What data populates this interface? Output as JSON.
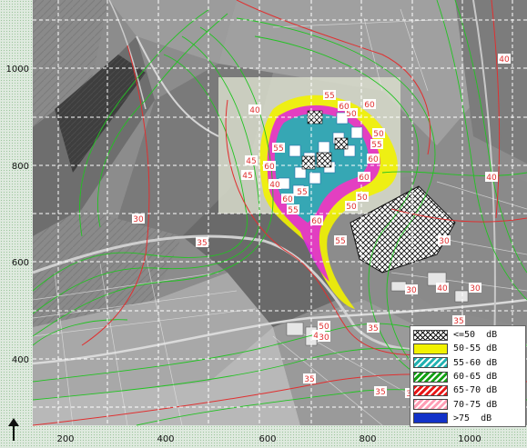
{
  "map": {
    "x_ticks": [
      "200",
      "400",
      "600",
      "800",
      "1000"
    ],
    "y_ticks": [
      "1000",
      "800",
      "600",
      "400"
    ],
    "contour_labels": [
      "55",
      "40",
      "50",
      "60",
      "60",
      "55",
      "45",
      "60",
      "50",
      "55",
      "60",
      "55",
      "50",
      "60",
      "45",
      "40",
      "50",
      "60",
      "55",
      "60",
      "55",
      "40",
      "30",
      "35",
      "50",
      "45",
      "35",
      "30",
      "35",
      "40",
      "30",
      "30",
      "30",
      "40",
      "35",
      "30",
      "35"
    ]
  },
  "legend": {
    "entries": [
      {
        "label": "<=50  dB",
        "color": "#ffffff",
        "pattern": "crosshatch"
      },
      {
        "label": "50-55 dB",
        "color": "#f2f200",
        "pattern": "solid"
      },
      {
        "label": "55-60 dB",
        "color": "#22b2b2",
        "pattern": "hatch"
      },
      {
        "label": "60-65 dB",
        "color": "#14a014",
        "pattern": "hatch"
      },
      {
        "label": "65-70 dB",
        "color": "#e81818",
        "pattern": "hatch"
      },
      {
        "label": "70-75 dB",
        "color": "#ff9eb5",
        "pattern": "hatch"
      },
      {
        "label": ">75  dB",
        "color": "#1232c8",
        "pattern": "solid"
      }
    ]
  },
  "colors": {
    "contour_red": "#e03030",
    "contour_green": "#22c322",
    "grid": "#ffffff",
    "zone_yellow": "#f2f200",
    "zone_magenta": "#e020e0",
    "zone_cyan": "#22b2b2"
  },
  "icons": {
    "north": "north-arrow-icon"
  }
}
